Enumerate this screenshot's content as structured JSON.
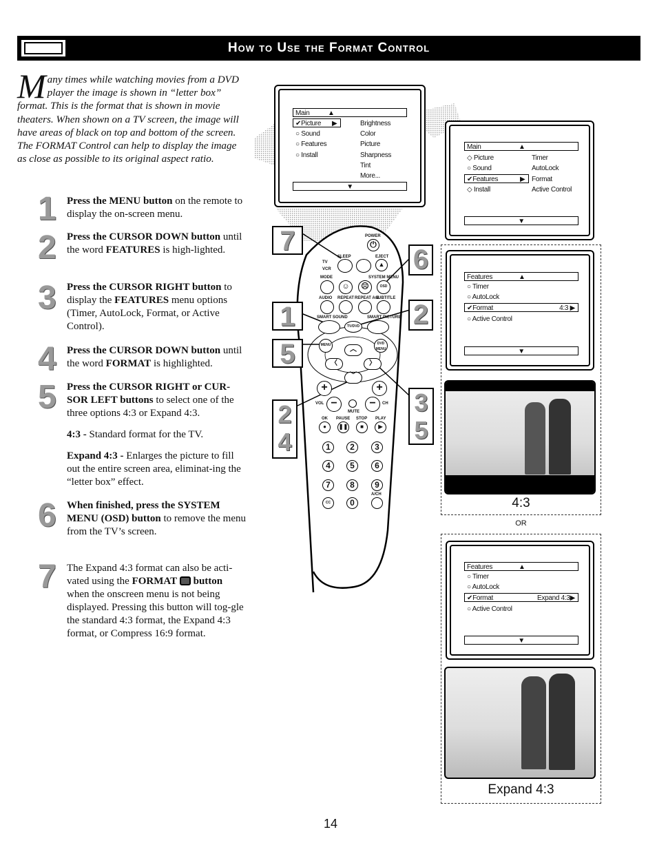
{
  "header": {
    "title": "How to Use the Format Control",
    "icon": "remote-hand-icon"
  },
  "intro": {
    "drop_cap": "M",
    "text": "any times while watching movies from a DVD player the image is shown in “letter box” format. This is the format that is shown in movie theaters. When shown on a TV screen, the image will have areas of black on top and bottom of the screen. The FORMAT Control can help to display the image as close as possible to its original aspect ratio."
  },
  "steps": [
    {
      "num": "1",
      "bold": "Press the MENU button",
      "rest": " on the remote to display the on-screen menu."
    },
    {
      "num": "2",
      "bold": "Press the CURSOR DOWN button",
      "rest": " until the word ",
      "bold2": "FEATURES",
      "rest2": " is high-lighted."
    },
    {
      "num": "3",
      "bold": "Press the CURSOR RIGHT button",
      "rest": " to display the ",
      "bold2": "FEATURES",
      "rest2": " menu options (Timer, AutoLock, Format, or Active Control)."
    },
    {
      "num": "4",
      "bold": "Press the CURSOR DOWN button",
      "rest": " until the word ",
      "bold2": "FORMAT",
      "rest2": " is highlighted."
    },
    {
      "num": "5",
      "bold": "Press the CURSOR RIGHT or CUR-SOR LEFT buttons",
      "rest": " to select one of the three options 4:3 or Expand 4:3."
    },
    {
      "num": "6",
      "bold": "When finished, press the SYSTEM MENU (OSD) button",
      "rest": " to remove the menu from the TV’s screen."
    },
    {
      "num": "7",
      "rest": "The Expand 4:3 format can also be acti-vated using the ",
      "bold": "FORMAT",
      "bold2": "button",
      "rest2": " when the onscreen menu is not being displayed. Pressing this button will tog-gle the standard 4:3 format, the Expand 4:3 format, or Compress 16:9 format."
    }
  ],
  "options": [
    {
      "bold": "4:3 -",
      "rest": " Standard format for the TV."
    },
    {
      "bold": "Expand 4:3 -",
      "rest": " Enlarges the picture to fill out the entire screen area, eliminat-ing the “letter box” effect."
    }
  ],
  "menus": {
    "main_picture": {
      "title": "Main",
      "items": [
        "✔Picture",
        "○ Sound",
        "○ Features",
        "○ Install"
      ],
      "sub": [
        "Brightness",
        "Color",
        "Picture",
        "Sharpness",
        "Tint",
        "More..."
      ]
    },
    "main_features": {
      "title": "Main",
      "items": [
        "◇ Picture",
        "○ Sound",
        "✔Features",
        "◇ Install"
      ],
      "sub": [
        "Timer",
        "AutoLock",
        "Format",
        "Active Control"
      ]
    },
    "features_43": {
      "title": "Features",
      "items": [
        "○ Timer",
        "○ AutoLock",
        "✔Format",
        "○ Active Control"
      ],
      "value": "4:3"
    },
    "features_expand": {
      "title": "Features",
      "items": [
        "○ Timer",
        "○ AutoLock",
        "✔Format",
        "○ Active Control"
      ],
      "value": "Expand 4:3"
    }
  },
  "captions": {
    "standard": "4:3",
    "or": "OR",
    "expand": "Expand 4:3"
  },
  "remote": {
    "labels": {
      "power": "POWER",
      "sleep": "SLEEP",
      "eject": "EJECT",
      "tv": "TV",
      "vcr": "VCR",
      "mode": "MODE",
      "system_menu": "SYSTEM MENU",
      "osd": "OSD",
      "audio": "AUDIO",
      "repeat": "REPEAT",
      "repeat_ab": "REPEAT A-B",
      "subtitle": "SUBTITLE",
      "smart_sound": "SMART SOUND",
      "smart_picture": "SMART PICTURE",
      "tvdvd": "TV/DVD",
      "menu": "MENU",
      "dvd_menu": "DVD MENU",
      "vol": "VOL",
      "ch": "CH",
      "mute": "MUTE",
      "ok": "OK",
      "pause": "PAUSE",
      "stop": "STOP",
      "play": "PLAY",
      "cc": "CC",
      "a_ch": "A/CH"
    },
    "digits": [
      "1",
      "2",
      "3",
      "4",
      "5",
      "6",
      "7",
      "8",
      "9",
      "0"
    ],
    "callouts": [
      "7",
      "1",
      "5",
      "2\n4",
      "6",
      "2",
      "3\n5"
    ]
  },
  "page_number": "14"
}
